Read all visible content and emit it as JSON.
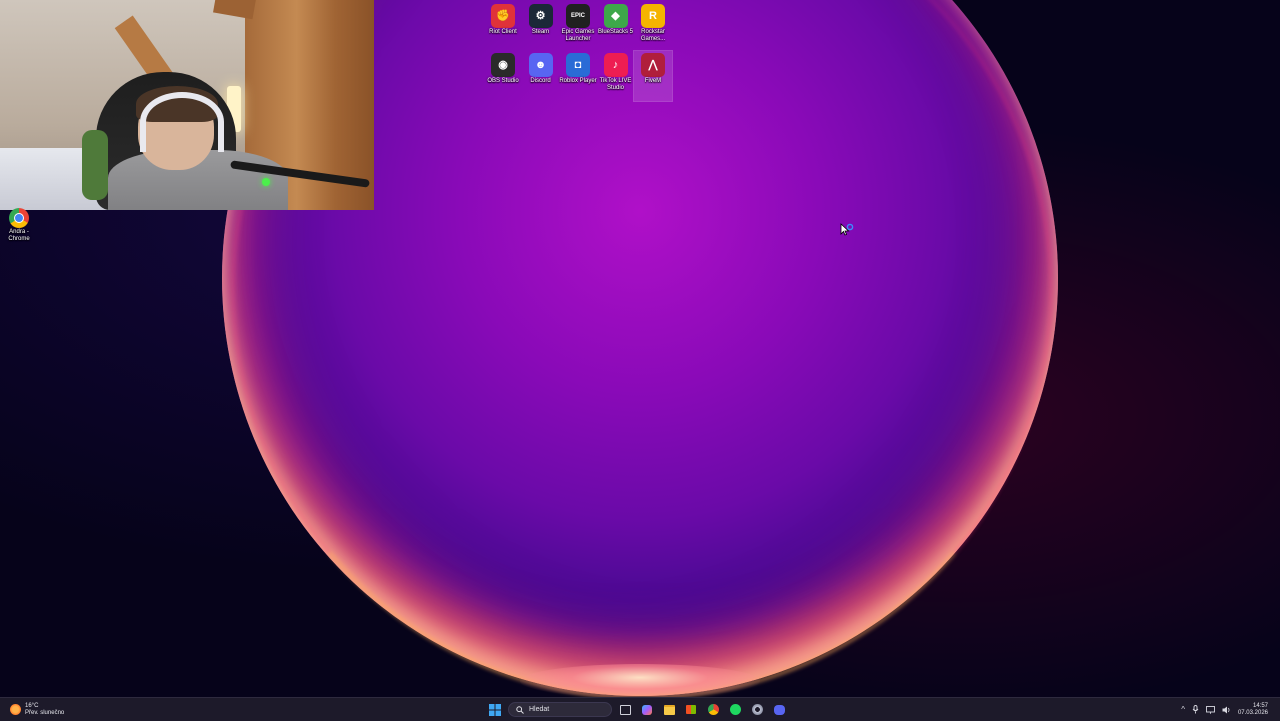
{
  "desktop": {
    "icons": [
      {
        "label": "Riot Client",
        "icon": "riot-client-icon",
        "color": "#e0323a",
        "glyph": "✊"
      },
      {
        "label": "Steam",
        "icon": "steam-icon",
        "color": "#1b2838",
        "glyph": "⚙"
      },
      {
        "label": "Epic Games Launcher",
        "icon": "epic-games-icon",
        "color": "#202020",
        "glyph": "EPIC"
      },
      {
        "label": "BlueStacks 5",
        "icon": "bluestacks-icon",
        "color": "#3ea84a",
        "glyph": "◆"
      },
      {
        "label": "Rockstar Games...",
        "icon": "rockstar-icon",
        "color": "#f5b400",
        "glyph": "R"
      },
      {
        "label": "OBS Studio",
        "icon": "obs-icon",
        "color": "#2a2a2a",
        "glyph": "◉"
      },
      {
        "label": "Discord",
        "icon": "discord-icon",
        "color": "#5865f2",
        "glyph": "☻"
      },
      {
        "label": "Roblox Player",
        "icon": "roblox-icon",
        "color": "#2a6bd6",
        "glyph": "◘"
      },
      {
        "label": "TikTok LIVE Studio",
        "icon": "tiktok-live-icon",
        "color": "#ee1d52",
        "glyph": "♪"
      },
      {
        "label": "FiveM",
        "icon": "fivem-icon",
        "color": "#b01e3c",
        "glyph": "⋀"
      }
    ],
    "left_icon": {
      "label": "Andra - Chrome",
      "icon": "chrome-icon"
    }
  },
  "taskbar": {
    "weather": {
      "temp": "16°C",
      "condition": "Přev. slunečno"
    },
    "search_placeholder": "Hledat",
    "apps": [
      "task-view-icon",
      "copilot-icon",
      "file-explorer-icon",
      "store-icon",
      "chrome-icon",
      "spotify-icon",
      "settings-icon",
      "discord-icon"
    ],
    "time": "14:57",
    "date": "07.03.2026"
  }
}
